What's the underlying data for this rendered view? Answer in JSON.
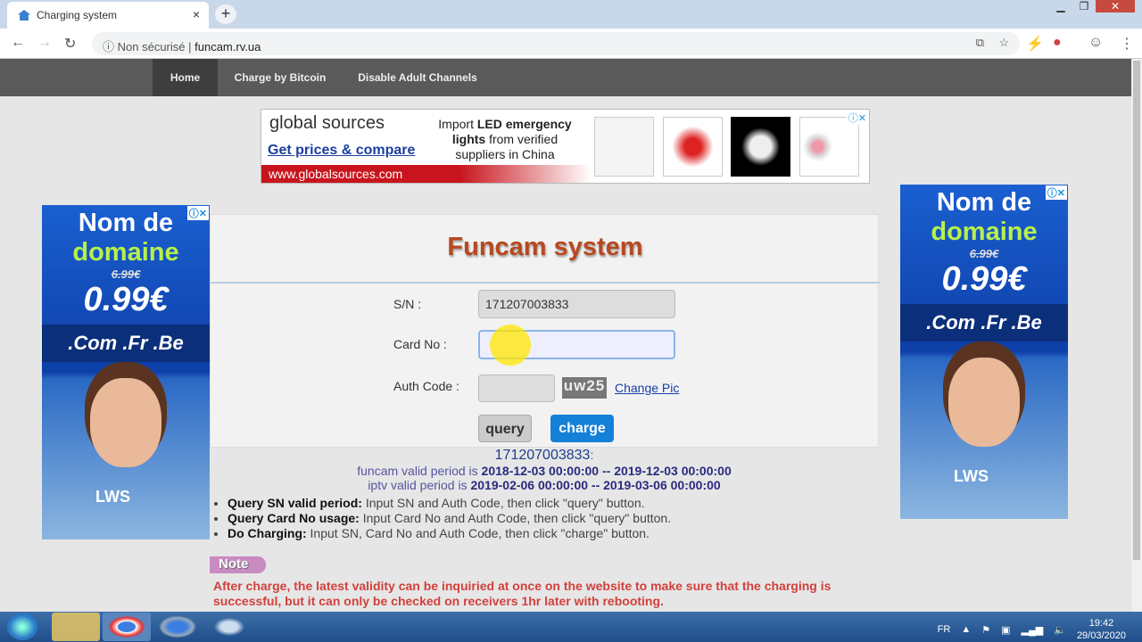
{
  "browser": {
    "tab_title": "Charging system",
    "new_tab": "+",
    "close_tab": "×",
    "security": "Non sécurisé",
    "url": "funcam.rv.ua"
  },
  "nav": {
    "items": [
      "Home",
      "Charge by Bitcoin",
      "Disable Adult Channels"
    ]
  },
  "top_ad": {
    "brand": "global sources",
    "cta": "Get prices & compare",
    "text_pre": "Import ",
    "text_bold": "LED emergency lights",
    "text_post": " from verified suppliers in China",
    "site": "www.globalsources.com"
  },
  "side_ad": {
    "line1": "Nom de",
    "line2": "domaine",
    "old_price": "6.99€",
    "price": "0.99€",
    "tlds": ".Com .Fr .Be",
    "logo": "LWS"
  },
  "form": {
    "title": "Funcam system",
    "sn_label": "S/N :",
    "sn_value": "171207003833",
    "card_label": "Card No :",
    "card_value": "",
    "auth_label": "Auth Code :",
    "auth_value": "",
    "captcha": "uw25",
    "change_pic": "Change Pic",
    "query": "query",
    "charge": "charge"
  },
  "info": {
    "sn": "171207003833",
    "sn_suffix": ":",
    "funcam_label": "funcam valid period is ",
    "funcam_period": "2018-12-03 00:00:00 -- 2019-12-03 00:00:00",
    "iptv_label": "iptv valid period is ",
    "iptv_period": "2019-02-06 00:00:00 -- 2019-03-06 00:00:00"
  },
  "instructions": [
    {
      "title": "Query SN valid period:",
      "text": " Input SN and Auth Code, then click \"query\" button."
    },
    {
      "title": "Query Card No usage:",
      "text": " Input Card No and Auth Code, then click \"query\" button."
    },
    {
      "title": "Do Charging:",
      "text": " Input SN, Card No and Auth Code, then click \"charge\" button."
    }
  ],
  "note": {
    "label": "Note",
    "text": "After charge, the latest validity can be inquiried at once on the website to make sure that the charging is successful, but it can only be checked on receivers 1hr later with rebooting."
  },
  "taskbar": {
    "lang": "FR",
    "time": "19:42",
    "date": "29/03/2020"
  }
}
